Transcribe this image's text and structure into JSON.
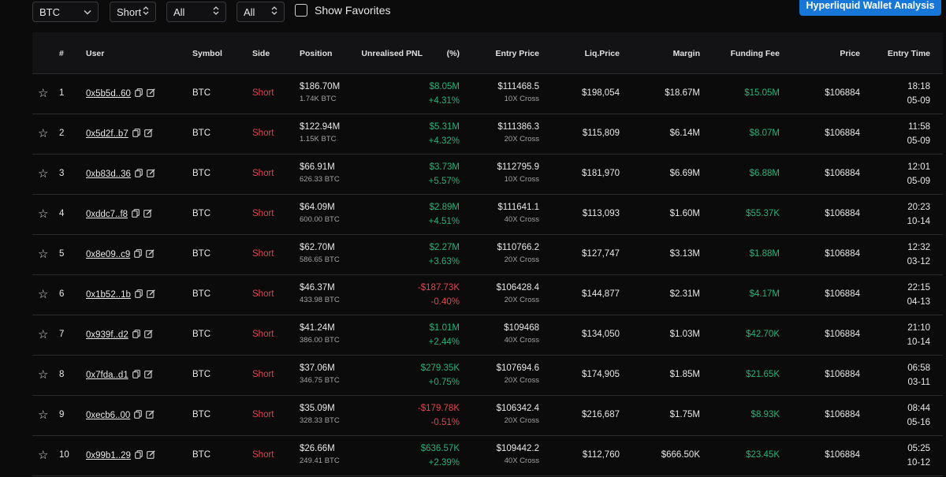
{
  "filters": {
    "symbol": "BTC",
    "side": "Short",
    "filter3": "All",
    "filter4": "All",
    "show_favorites": "Show Favorites"
  },
  "analysis_button": "Hyperliquid Wallet Analysis",
  "columns": {
    "num": "#",
    "user": "User",
    "symbol": "Symbol",
    "side": "Side",
    "position": "Position",
    "pnl": "Unrealised PNL",
    "pct": "(%)",
    "entry_price": "Entry Price",
    "liq_price": "Liq.Price",
    "margin": "Margin",
    "funding_fee": "Funding Fee",
    "price": "Price",
    "entry_time": "Entry Time"
  },
  "rows": [
    {
      "idx": "1",
      "user": "0x5b5d..60",
      "symbol": "BTC",
      "side": "Short",
      "position": "$186.70M",
      "size": "1.74K BTC",
      "pnl": "$8.05M",
      "pct": "+4.31%",
      "pnl_sign": "pos",
      "entry": "$111468.5",
      "lev": "10X Cross",
      "liq": "$198,054",
      "margin": "$18.67M",
      "fee": "$15.05M",
      "price": "$106884",
      "time": "18:18",
      "date": "05-09"
    },
    {
      "idx": "2",
      "user": "0x5d2f..b7",
      "symbol": "BTC",
      "side": "Short",
      "position": "$122.94M",
      "size": "1.15K BTC",
      "pnl": "$5.31M",
      "pct": "+4.32%",
      "pnl_sign": "pos",
      "entry": "$111386.3",
      "lev": "20X Cross",
      "liq": "$115,809",
      "margin": "$6.14M",
      "fee": "$8.07M",
      "price": "$106884",
      "time": "11:58",
      "date": "05-09"
    },
    {
      "idx": "3",
      "user": "0xb83d..36",
      "symbol": "BTC",
      "side": "Short",
      "position": "$66.91M",
      "size": "626.33 BTC",
      "pnl": "$3.73M",
      "pct": "+5.57%",
      "pnl_sign": "pos",
      "entry": "$112795.9",
      "lev": "10X Cross",
      "liq": "$181,970",
      "margin": "$6.69M",
      "fee": "$6.88M",
      "price": "$106884",
      "time": "12:01",
      "date": "05-09"
    },
    {
      "idx": "4",
      "user": "0xddc7..f8",
      "symbol": "BTC",
      "side": "Short",
      "position": "$64.09M",
      "size": "600.00 BTC",
      "pnl": "$2.89M",
      "pct": "+4.51%",
      "pnl_sign": "pos",
      "entry": "$111641.1",
      "lev": "40X Cross",
      "liq": "$113,093",
      "margin": "$1.60M",
      "fee": "$55.37K",
      "price": "$106884",
      "time": "20:23",
      "date": "10-14"
    },
    {
      "idx": "5",
      "user": "0x8e09..c9",
      "symbol": "BTC",
      "side": "Short",
      "position": "$62.70M",
      "size": "586.65 BTC",
      "pnl": "$2.27M",
      "pct": "+3.63%",
      "pnl_sign": "pos",
      "entry": "$110766.2",
      "lev": "20X Cross",
      "liq": "$127,747",
      "margin": "$3.13M",
      "fee": "$1.88M",
      "price": "$106884",
      "time": "12:32",
      "date": "03-12"
    },
    {
      "idx": "6",
      "user": "0x1b52..1b",
      "symbol": "BTC",
      "side": "Short",
      "position": "$46.37M",
      "size": "433.98 BTC",
      "pnl": "-$187.73K",
      "pct": "-0.40%",
      "pnl_sign": "neg",
      "entry": "$106428.4",
      "lev": "20X Cross",
      "liq": "$144,877",
      "margin": "$2.31M",
      "fee": "$4.17M",
      "price": "$106884",
      "time": "22:15",
      "date": "04-13"
    },
    {
      "idx": "7",
      "user": "0x939f..d2",
      "symbol": "BTC",
      "side": "Short",
      "position": "$41.24M",
      "size": "386.00 BTC",
      "pnl": "$1.01M",
      "pct": "+2.44%",
      "pnl_sign": "pos",
      "entry": "$109468",
      "lev": "40X Cross",
      "liq": "$134,050",
      "margin": "$1.03M",
      "fee": "$42.70K",
      "price": "$106884",
      "time": "21:10",
      "date": "10-14"
    },
    {
      "idx": "8",
      "user": "0x7fda..d1",
      "symbol": "BTC",
      "side": "Short",
      "position": "$37.06M",
      "size": "346.75 BTC",
      "pnl": "$279.35K",
      "pct": "+0.75%",
      "pnl_sign": "pos",
      "entry": "$107694.6",
      "lev": "20X Cross",
      "liq": "$174,905",
      "margin": "$1.85M",
      "fee": "$21.65K",
      "price": "$106884",
      "time": "06:58",
      "date": "03-11"
    },
    {
      "idx": "9",
      "user": "0xecb6..00",
      "symbol": "BTC",
      "side": "Short",
      "position": "$35.09M",
      "size": "328.33 BTC",
      "pnl": "-$179.78K",
      "pct": "-0.51%",
      "pnl_sign": "neg",
      "entry": "$106342.4",
      "lev": "20X Cross",
      "liq": "$216,687",
      "margin": "$1.75M",
      "fee": "$8.93K",
      "price": "$106884",
      "time": "08:44",
      "date": "05-16"
    },
    {
      "idx": "10",
      "user": "0x99b1..29",
      "symbol": "BTC",
      "side": "Short",
      "position": "$26.66M",
      "size": "249.41 BTC",
      "pnl": "$636.57K",
      "pct": "+2.39%",
      "pnl_sign": "pos",
      "entry": "$109442.2",
      "lev": "40X Cross",
      "liq": "$112,760",
      "margin": "$666.50K",
      "fee": "$23.45K",
      "price": "$106884",
      "time": "05:25",
      "date": "10-12"
    }
  ],
  "colors": {
    "positive": "#26b378",
    "negative": "#e2444d",
    "accent": "#1677d8"
  }
}
